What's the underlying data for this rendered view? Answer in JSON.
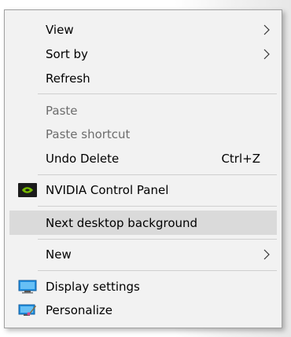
{
  "menu": {
    "view": "View",
    "sort_by": "Sort by",
    "refresh": "Refresh",
    "paste": "Paste",
    "paste_shortcut": "Paste shortcut",
    "undo_delete": "Undo Delete",
    "undo_shortcut": "Ctrl+Z",
    "nvidia": "NVIDIA Control Panel",
    "next_background": "Next desktop background",
    "new": "New",
    "display_settings": "Display settings",
    "personalize": "Personalize"
  },
  "icons": {
    "submenu_arrow": "chevron-right-icon",
    "nvidia": "nvidia-logo-icon",
    "display": "monitor-icon",
    "personalize": "monitor-brush-icon"
  },
  "colors": {
    "menu_bg": "#f2f2f2",
    "hover_bg": "#dadada",
    "disabled_text": "#6d6d6d",
    "nvidia_green": "#76b900",
    "display_blue": "#1f8fe0"
  }
}
